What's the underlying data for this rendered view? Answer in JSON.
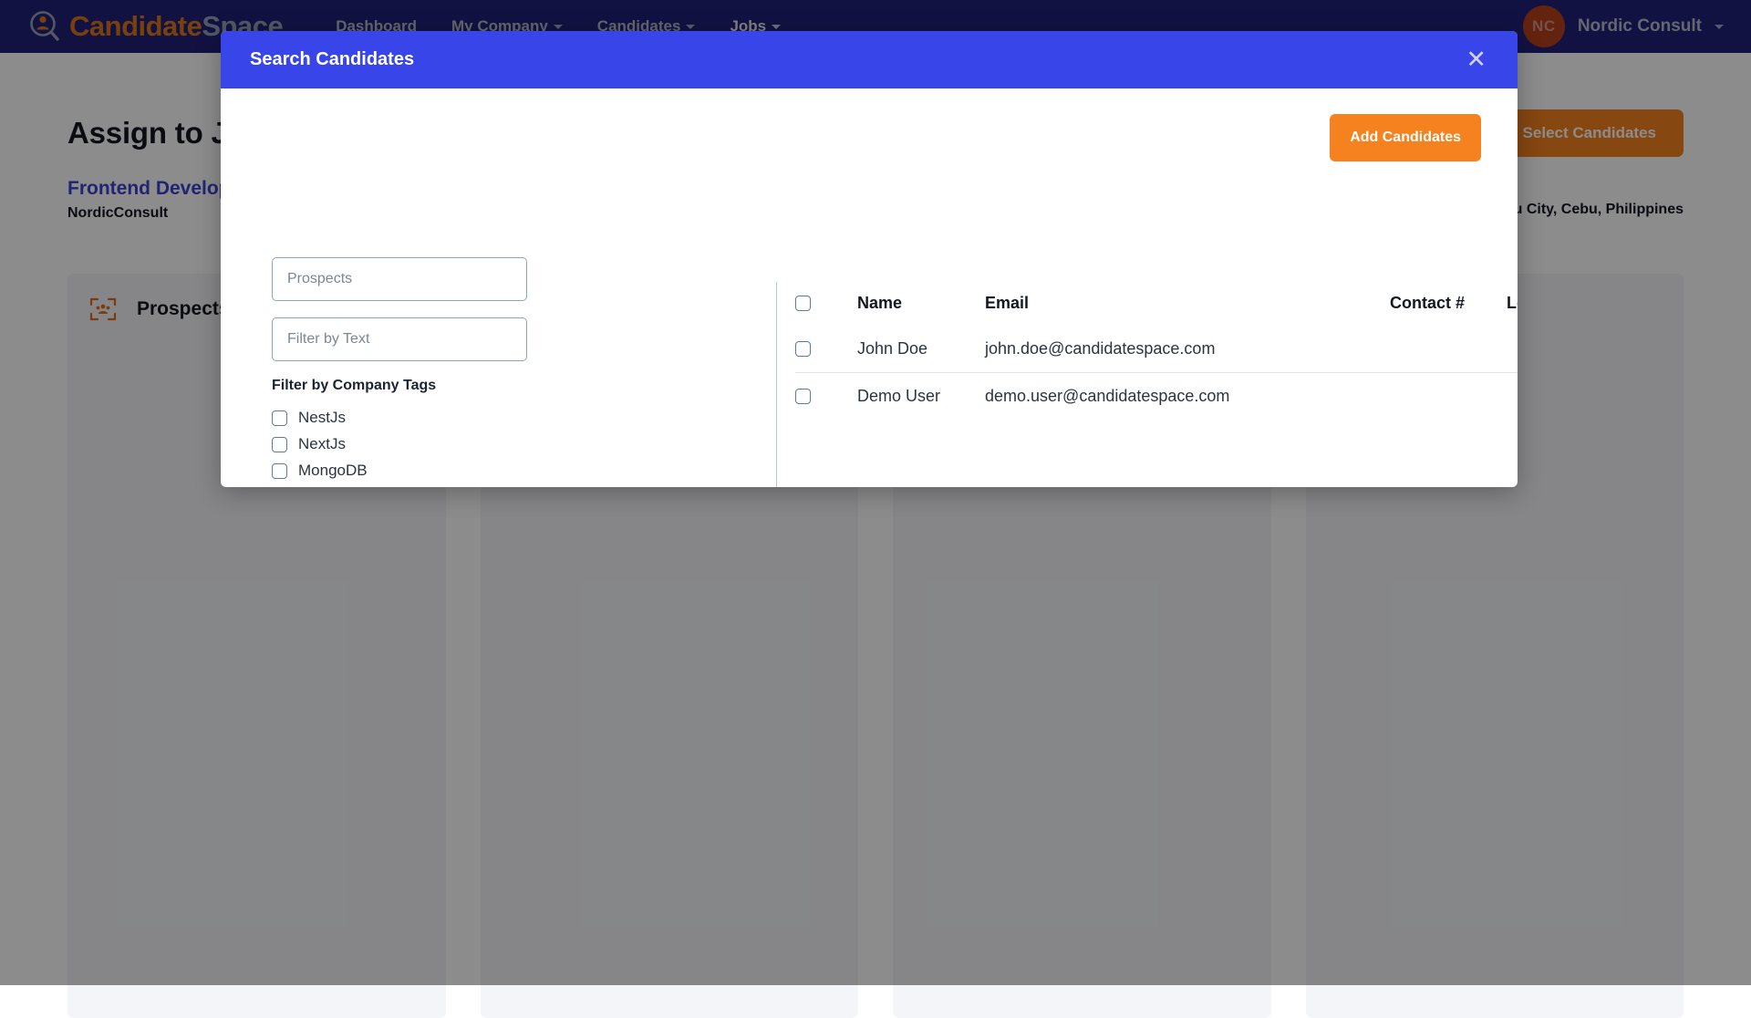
{
  "navbar": {
    "brand_primary": "Candidate",
    "brand_secondary": "Space",
    "links": [
      {
        "label": "Dashboard",
        "has_caret": false,
        "active": false
      },
      {
        "label": "My Company",
        "has_caret": true,
        "active": false
      },
      {
        "label": "Candidates",
        "has_caret": true,
        "active": false
      },
      {
        "label": "Jobs",
        "has_caret": true,
        "active": true
      }
    ],
    "user": {
      "initials": "NC",
      "name": "Nordic Consult"
    },
    "background_color": "#1f2179",
    "brand_accent_color": "#d9761a"
  },
  "page": {
    "title": "Assign to Job",
    "select_candidates_label": "Select Candidates",
    "job_title": "Frontend Developer",
    "job_company": "NordicConsult",
    "job_location": "Cebu City, Cebu, Philippines",
    "columns": [
      {
        "title": "Prospects",
        "icon": "people-scan-icon"
      },
      {
        "title": "",
        "icon": ""
      },
      {
        "title": "",
        "icon": ""
      },
      {
        "title": "",
        "icon": ""
      }
    ]
  },
  "modal": {
    "title": "Search Candidates",
    "close_icon": "close-icon",
    "header_color": "#3845e8",
    "add_candidates_label": "Add Candidates",
    "add_candidates_color": "#f5821f",
    "filters": {
      "prospects_value": "",
      "prospects_placeholder": "Prospects",
      "text_value": "",
      "text_placeholder": "Filter by Text",
      "company_tags_label": "Filter by Company Tags",
      "company_tags": [
        {
          "label": "NestJs",
          "checked": false
        },
        {
          "label": "NextJs",
          "checked": false
        },
        {
          "label": "MongoDB",
          "checked": false
        }
      ]
    },
    "table": {
      "select_all_checked": false,
      "headers": [
        "Name",
        "Email",
        "Contact #",
        "Location"
      ],
      "rows": [
        {
          "checked": false,
          "name": "John Doe",
          "email": "john.doe@candidatespace.com",
          "contact": "",
          "location": ""
        },
        {
          "checked": false,
          "name": "Demo User",
          "email": "demo.user@candidatespace.com",
          "contact": "",
          "location": ""
        }
      ]
    }
  }
}
